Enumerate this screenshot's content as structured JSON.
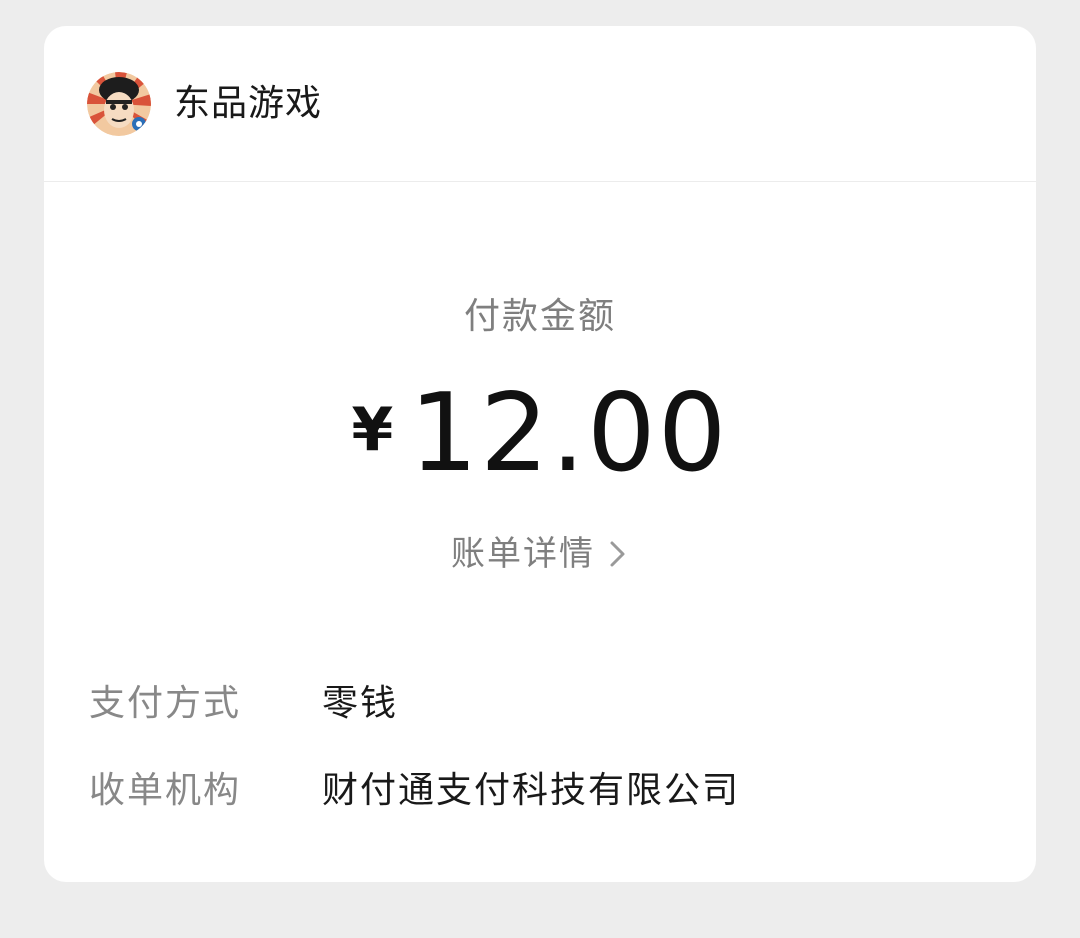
{
  "merchant": {
    "name": "东品游戏",
    "avatar_icon": "cartoon-avatar-icon"
  },
  "payment": {
    "amount_label": "付款金额",
    "currency_symbol": "¥",
    "amount": "12.00",
    "bill_detail_label": "账单详情"
  },
  "details": [
    {
      "label": "支付方式",
      "value": "零钱"
    },
    {
      "label": "收单机构",
      "value": "财付通支付科技有限公司"
    }
  ],
  "colors": {
    "background": "#ededed",
    "card": "#ffffff",
    "primary_text": "#191919",
    "secondary_text": "#7f7f7f"
  }
}
